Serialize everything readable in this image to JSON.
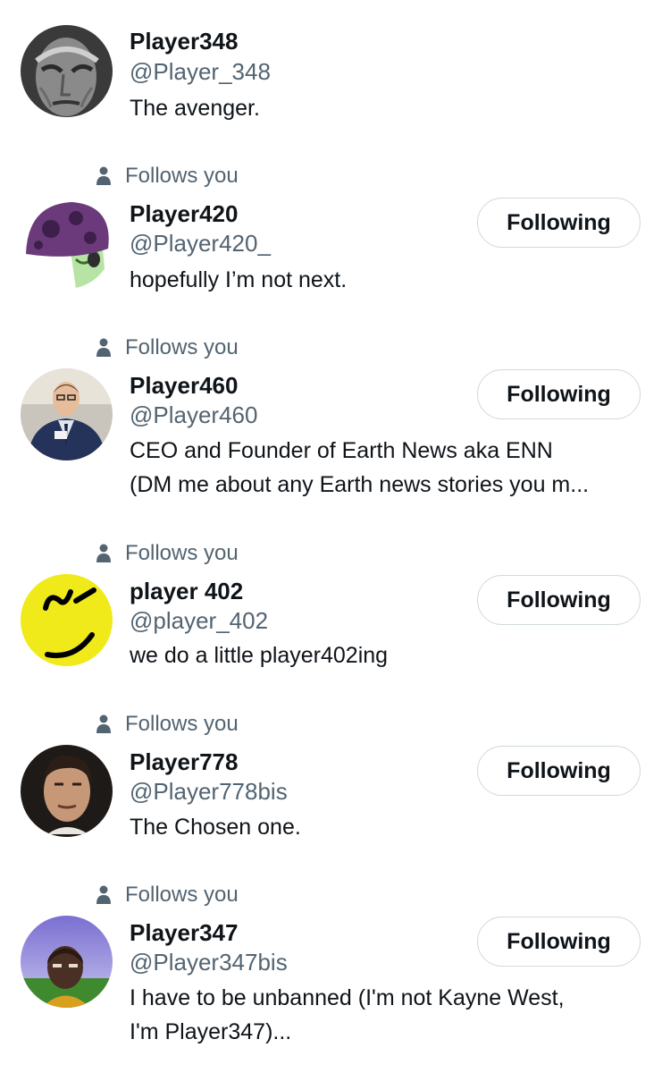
{
  "users": [
    {
      "name": "Player348",
      "handle": "@Player_348",
      "bio": [
        "The avenger."
      ],
      "follows_you": false,
      "button": null,
      "avatar": "gray-face-avatar"
    },
    {
      "name": "Player420",
      "handle": "@Player420_",
      "bio": [
        "hopefully I’m not next."
      ],
      "follows_you": true,
      "follows_you_label": "Follows you",
      "button": "Following",
      "avatar": "purple-mushroom-avatar"
    },
    {
      "name": "Player460",
      "handle": "@Player460",
      "bio": [
        "CEO and Founder of Earth News aka ENN",
        "(DM me about any Earth news stories you m..."
      ],
      "follows_you": true,
      "follows_you_label": "Follows you",
      "button": "Following",
      "avatar": "reporter-avatar"
    },
    {
      "name": "player 402",
      "handle": "@player_402",
      "bio": [
        "we do a little player402ing"
      ],
      "follows_you": true,
      "follows_you_label": "Follows you",
      "button": "Following",
      "avatar": "yellow-smiley-avatar"
    },
    {
      "name": "Player778",
      "handle": "@Player778bis",
      "bio": [
        "The Chosen one."
      ],
      "follows_you": true,
      "follows_you_label": "Follows you",
      "button": "Following",
      "avatar": "man-face-avatar"
    },
    {
      "name": "Player347",
      "handle": "@Player347bis",
      "bio": [
        "I have to be unbanned (I'm not Kayne West,",
        "I'm Player347)..."
      ],
      "follows_you": true,
      "follows_you_label": "Follows you",
      "button": "Following",
      "avatar": "game-character-avatar"
    }
  ],
  "colors": {
    "text_primary": "#0f1419",
    "text_secondary": "#536471",
    "button_border": "#cfd9de"
  }
}
